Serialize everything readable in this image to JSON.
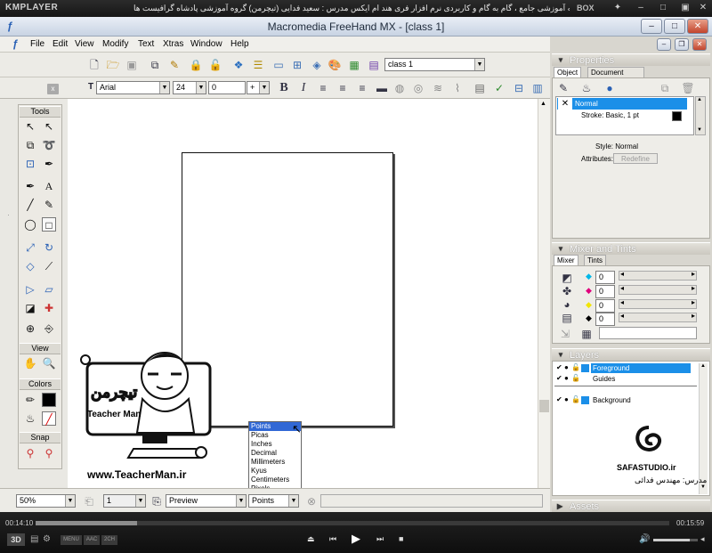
{
  "player": {
    "logo": "KMPLAYER",
    "title": "مجموعه آموزشی جامع ، گام به گام و کاربردی نرم افزار فری هند ام ایکس   مدرس : سعید فدایی (تیچرمن) گروه آموزشی پادشاه گرافیست ها",
    "box_label": "BOX",
    "time_current": "00:14:10",
    "time_total": "00:15:59",
    "progress": 0.16,
    "volume": 0.82,
    "badges": [
      "3D",
      "MENU",
      "AAC",
      "2CH"
    ],
    "colors": {
      "bar": "#161616",
      "progress": "#8c8c8c"
    }
  },
  "app": {
    "title": "Macromedia FreeHand MX - [class 1]",
    "menus": [
      "File",
      "Edit",
      "View",
      "Modify",
      "Text",
      "Xtras",
      "Window",
      "Help"
    ],
    "document_combo": "class 1",
    "font_combo": "Arial",
    "size_combo": "24",
    "leading_value": "0",
    "leading_mode": "+"
  },
  "tools": {
    "title": "Tools",
    "view_label": "View",
    "colors_label": "Colors",
    "snap_label": "Snap"
  },
  "units_dropdown": {
    "options": [
      "Points",
      "Picas",
      "Inches",
      "Decimal",
      "Millimeters",
      "Kyus",
      "Centimeters",
      "Pixels"
    ],
    "selected": "Points"
  },
  "status": {
    "zoom": "50%",
    "page": "1",
    "view_mode": "Preview",
    "units": "Points"
  },
  "properties": {
    "header": "Properties",
    "tabs": [
      "Object",
      "Document"
    ],
    "items": [
      "Normal",
      "Stroke: Basic, 1 pt"
    ],
    "style_label": "Style: Normal",
    "attributes_label": "Attributes:",
    "redefine_button": "Redefine"
  },
  "mixer": {
    "header": "Mixer and Tints",
    "tabs": [
      "Mixer",
      "Tints"
    ],
    "values": [
      "0",
      "0",
      "0",
      "0"
    ],
    "channel_colors": [
      "#00b7e8",
      "#e0007c",
      "#f2e500",
      "#000000"
    ]
  },
  "layers": {
    "header": "Layers",
    "items": [
      "Foreground",
      "Guides",
      "Background"
    ],
    "highlight": "#1b8fe8"
  },
  "assets": {
    "header": "Assets"
  },
  "watermark": {
    "site": "www.TeacherMan.ir",
    "name": "Teacher Man",
    "studio": "SAFASTUDIO.ir",
    "credit": "مدرس: مهندس فدائی"
  }
}
